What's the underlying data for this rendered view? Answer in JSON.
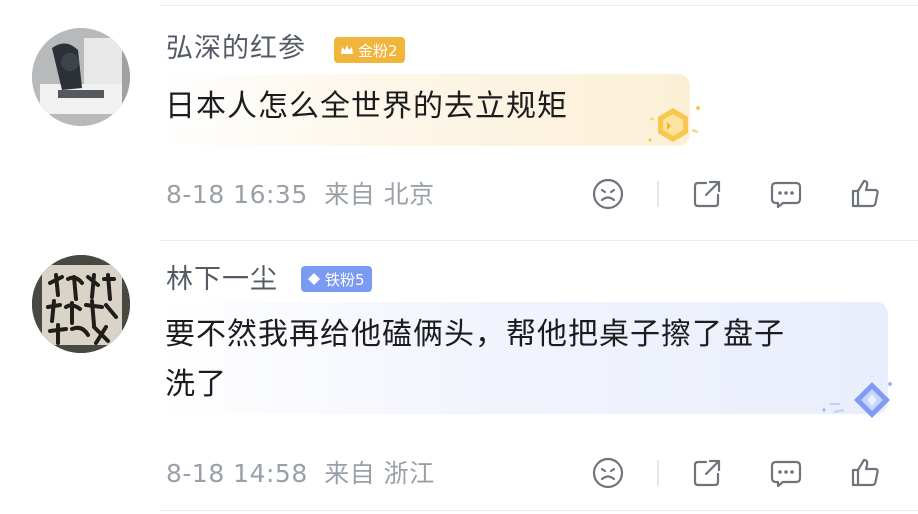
{
  "comments": [
    {
      "username": "弘深的红参",
      "badge": {
        "label": "金粉2",
        "color": "#F2B53C",
        "icon": "crown-icon"
      },
      "text": "日本人怎么全世界的去立规矩",
      "date": "8-18 16:35",
      "location": "来自 北京",
      "bubble_style": "gold-fan-bubble"
    },
    {
      "username": "林下一尘",
      "badge": {
        "label": "铁粉5",
        "color": "#7B9BF2",
        "icon": "diamond-icon"
      },
      "text_line1": "要不然我再给他磕俩头，帮他把桌子擦了盘子",
      "text_line2": "洗了",
      "date": "8-18 14:58",
      "location": "来自 浙江",
      "bubble_style": "iron-fan-bubble"
    }
  ],
  "actions": [
    "dislike-icon",
    "share-icon",
    "reply-icon",
    "like-icon"
  ]
}
